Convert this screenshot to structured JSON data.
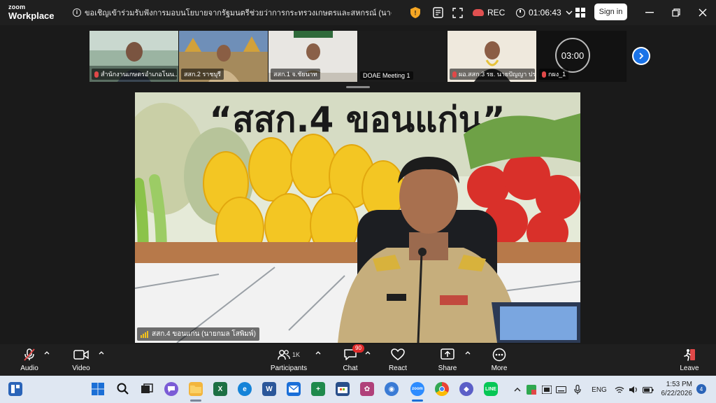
{
  "window": {
    "logo_line1": "zoom",
    "logo_line2": "Workplace",
    "meeting_title": "ขอเชิญเข้าร่วมรับฟังการมอบนโยบายจากรัฐมนตรีช่วยว่าการกระทรวงเกษตรและสหกรณ์ (นางสาวปิยะรัฐชย์ ติยะไพรัช) ภายใต้",
    "rec_label": "REC",
    "elapsed": "01:06:43",
    "sign_in_label": "Sign in"
  },
  "thumbnails": [
    {
      "label": "สำนักงานเกษตรอำเภอโนน...",
      "muted": true
    },
    {
      "label": "สสก.2 ราชบุรี",
      "muted": false
    },
    {
      "label": "สสก.1 จ.ชัยนาท",
      "muted": false
    },
    {
      "label": "DOAE Meeting 1",
      "muted": false
    },
    {
      "label": "ผอ.สสก.3 รย. นายปัญญา ประ...",
      "muted": true
    },
    {
      "label": "กผง_1",
      "muted": true,
      "countdown": "03:00"
    }
  ],
  "main_video": {
    "speaker_label": "สสก.4 ขอนแก่น (นายกมล โสพิมพ์)",
    "banner_text": "“สสก.4 ขอนแก่น”"
  },
  "toolbar": {
    "audio_label": "Audio",
    "video_label": "Video",
    "participants_label": "Participants",
    "participants_count": "1K",
    "chat_label": "Chat",
    "chat_badge": "90",
    "react_label": "React",
    "share_label": "Share",
    "more_label": "More",
    "leave_label": "Leave"
  },
  "taskbar": {
    "lang": "ENG",
    "time": "1:53 PM",
    "date": "6/22/2026",
    "notifications": "4"
  },
  "colors": {
    "title_bg": "#1f1f1f",
    "zoom_blue": "#1a73e8",
    "mute_red": "#e04848",
    "taskbar_bg": "#dfe7f2"
  }
}
